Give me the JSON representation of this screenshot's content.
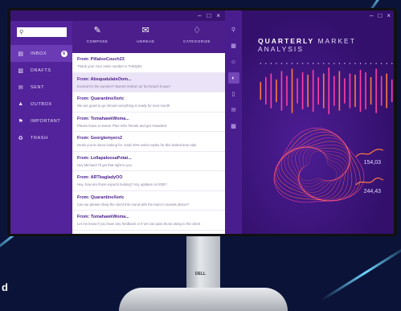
{
  "backdrop": {
    "corner_text": "d"
  },
  "monitor": {
    "brand": "DELL"
  },
  "mail_app": {
    "window_controls": [
      "–",
      "□",
      "×"
    ],
    "search": {
      "placeholder": ""
    },
    "sidebar": [
      {
        "label": "INBOX",
        "icon": "inbox-icon",
        "badge": "6",
        "active": true
      },
      {
        "label": "DRAFTS",
        "icon": "document-icon"
      },
      {
        "label": "SENT",
        "icon": "envelope-icon"
      },
      {
        "label": "OUTBOX",
        "icon": "outbox-icon"
      },
      {
        "label": "IMPORTANT",
        "icon": "flag-icon"
      },
      {
        "label": "TRASH",
        "icon": "trash-icon"
      }
    ],
    "toolbar": [
      {
        "label": "COMPOSE",
        "icon": "pencil-icon"
      },
      {
        "label": "UNREAD",
        "icon": "envelope-icon"
      },
      {
        "label": "CATEGORIZE",
        "icon": "tag-icon"
      }
    ],
    "emails": [
      {
        "from": "From: PillalooCouch23",
        "preview": "Thank you! Your order number is TH8Q3G",
        "selected": false
      },
      {
        "from": "From: AbsquatulateOom...",
        "preview": "Excited for the summer? Burrett invited our fun beach house!",
        "selected": true
      },
      {
        "from": "From: QuarantineXeric",
        "preview": "We are good to go Almost everything is ready for next month",
        "selected": false
      },
      {
        "from": "From: TomahawkWoma...",
        "preview": "Please leave a review. Plus refer friends and get rewarded",
        "selected": false
      },
      {
        "from": "From: Georgiemyers2",
        "preview": "Deals you've been looking for. Grab 40% select styles for this limited time sale",
        "selected": false
      },
      {
        "from": "From: LollapaloosaPotat...",
        "preview": "Hey Michael! I'll get that right to you",
        "selected": false
      },
      {
        "from": "From: ARTbagladyOO",
        "preview": "Hey, how are those exports looking? Any updates on E0E?",
        "selected": false
      },
      {
        "from": "From: QuarantineXeric",
        "preview": "Can we please show the client this round with the team's caveats above?",
        "selected": false
      },
      {
        "from": "From: TomahawkWoma...",
        "preview": "Let me know if you have any feedback or if we can pass those along to the client",
        "selected": false
      }
    ]
  },
  "dashboard": {
    "window_controls": [
      "–",
      "□",
      "×"
    ],
    "title_bold": "QUARTERLY",
    "title_rest": " MARKET ANALYSIS",
    "rail_icons": [
      "search-icon",
      "grid-icon",
      "user-add-icon",
      "chart-icon",
      "chat-icon",
      "mail-icon",
      "gallery-icon"
    ],
    "metrics": [
      "154,03",
      "244,43"
    ],
    "bar_levels": [
      0.35,
      0.55,
      0.7,
      0.45,
      0.8,
      0.6,
      0.9,
      0.5,
      0.75,
      0.65,
      0.85,
      0.55,
      0.7,
      0.95,
      0.6,
      0.8,
      0.5,
      0.7,
      0.65,
      0.85,
      0.75,
      0.55,
      0.9,
      0.6,
      0.7,
      0.45
    ],
    "accent": "#ff7a45",
    "accent2": "#ff3fa4"
  }
}
